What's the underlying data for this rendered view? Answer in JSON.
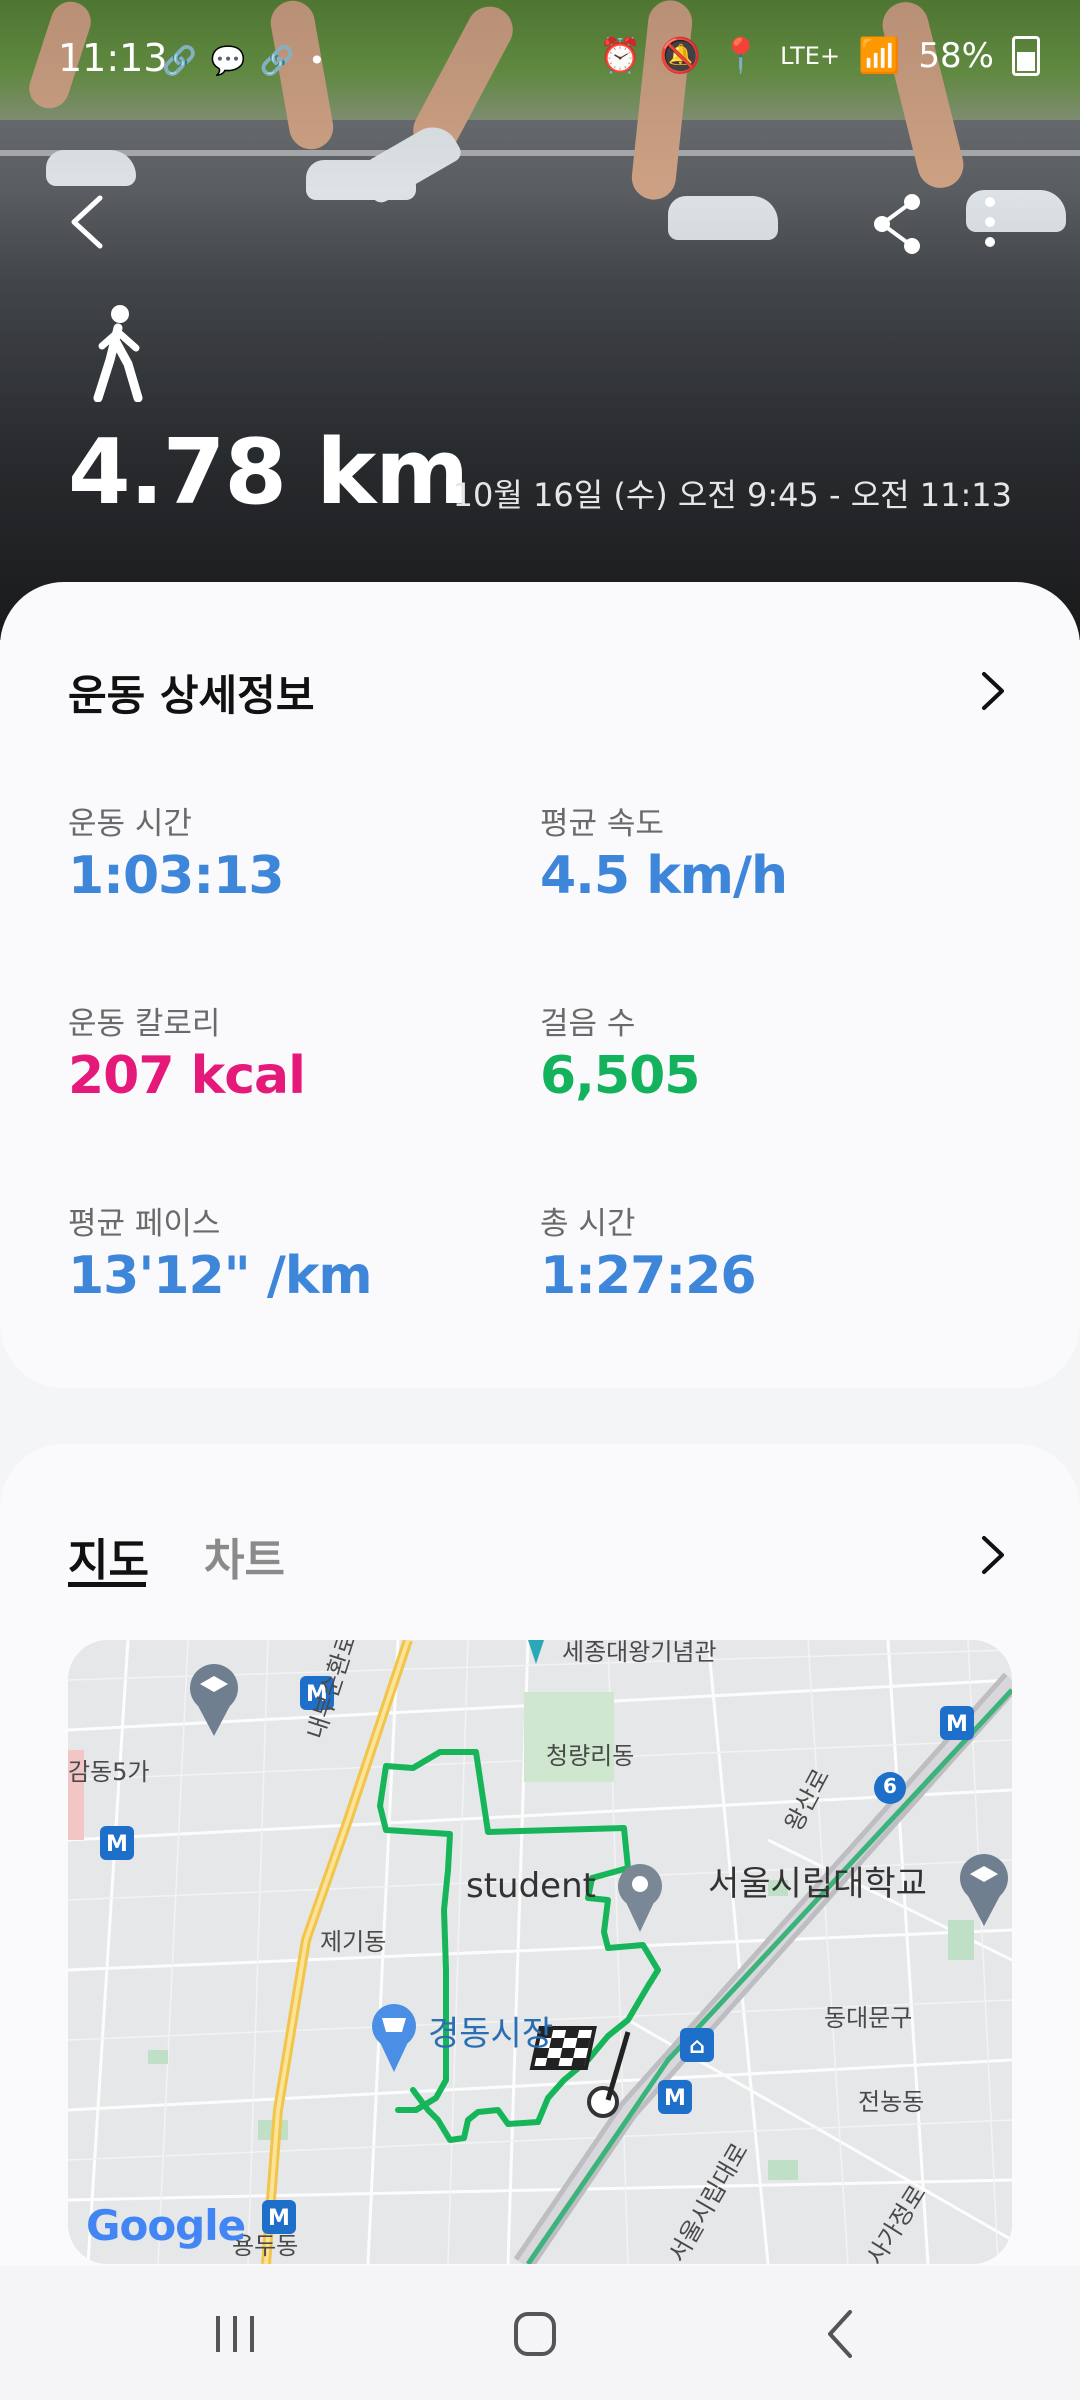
{
  "status_bar": {
    "time": "11:13",
    "network": "LTE+",
    "battery": "58%"
  },
  "header": {
    "distance": "4.78 km",
    "date_range": "10월 16일 (수) 오전 9:45 - 오전 11:13"
  },
  "details": {
    "title": "운동 상세정보",
    "stats": [
      {
        "label": "운동 시간",
        "value": "1:03:13",
        "color": "#3d86d9"
      },
      {
        "label": "평균 속도",
        "value": "4.5 km/h",
        "color": "#3d86d9"
      },
      {
        "label": "운동 칼로리",
        "value": "207 kcal",
        "color": "#e5197a"
      },
      {
        "label": "걸음 수",
        "value": "6,505",
        "color": "#14b25c"
      },
      {
        "label": "평균 페이스",
        "value": "13'12\" /km",
        "color": "#3d86d9"
      },
      {
        "label": "총 시간",
        "value": "1:27:26",
        "color": "#3d86d9"
      }
    ]
  },
  "map_section": {
    "tabs": [
      "지도",
      "차트"
    ],
    "active_tab": "지도",
    "labels": {
      "gangdong": "감동5가",
      "naebu": "내부순환로",
      "cheongnyangni": "청량리동",
      "wangsan": "왕산로",
      "student": "student",
      "univ": "서울시립대학교",
      "jegi": "제기동",
      "market": "경동시장",
      "dongdaemun": "동대문구",
      "jeonnong": "전농동",
      "seoulsirip": "서울시립대로",
      "sagajeong": "사가정로",
      "yongdu": "용두동",
      "top_partial": "세종대왕기념관",
      "route_six": "6"
    },
    "attribution": "Google",
    "route_color": "#17b55a"
  }
}
